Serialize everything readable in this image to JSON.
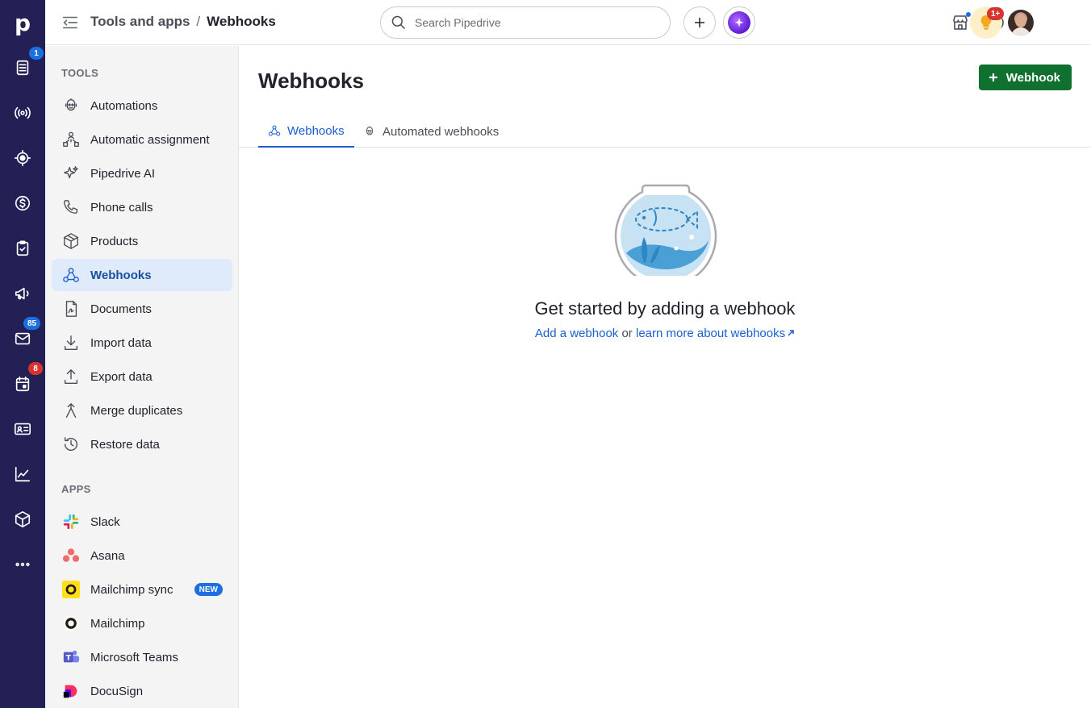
{
  "rail": {
    "logo": "p",
    "badges": {
      "leads": "1",
      "mail": "85",
      "calendar": "8"
    }
  },
  "topbar": {
    "breadcrumb_parent": "Tools and apps",
    "breadcrumb_sep": "/",
    "breadcrumb_current": "Webhooks",
    "search_placeholder": "Search Pipedrive",
    "notif_badge": "1+"
  },
  "sidebar": {
    "tools_title": "TOOLS",
    "tools": [
      {
        "label": "Automations",
        "icon": "automation-robot-icon"
      },
      {
        "label": "Automatic assignment",
        "icon": "assignment-icon"
      },
      {
        "label": "Pipedrive AI",
        "icon": "sparkle-icon"
      },
      {
        "label": "Phone calls",
        "icon": "phone-icon"
      },
      {
        "label": "Products",
        "icon": "box-icon"
      },
      {
        "label": "Webhooks",
        "icon": "webhook-icon",
        "active": true
      },
      {
        "label": "Documents",
        "icon": "document-icon"
      },
      {
        "label": "Import data",
        "icon": "download-icon"
      },
      {
        "label": "Export data",
        "icon": "upload-icon"
      },
      {
        "label": "Merge duplicates",
        "icon": "merge-icon"
      },
      {
        "label": "Restore data",
        "icon": "restore-icon"
      }
    ],
    "apps_title": "APPS",
    "apps": [
      {
        "label": "Slack",
        "icon": "slack-icon"
      },
      {
        "label": "Asana",
        "icon": "asana-icon"
      },
      {
        "label": "Mailchimp sync",
        "icon": "mailchimp-sync-icon",
        "badge": "NEW"
      },
      {
        "label": "Mailchimp",
        "icon": "mailchimp-icon"
      },
      {
        "label": "Microsoft Teams",
        "icon": "teams-icon"
      },
      {
        "label": "DocuSign",
        "icon": "docusign-icon"
      }
    ]
  },
  "main": {
    "title": "Webhooks",
    "add_button": "Webhook",
    "tabs": [
      {
        "label": "Webhooks",
        "active": true
      },
      {
        "label": "Automated webhooks",
        "active": false
      }
    ],
    "empty_title": "Get started by adding a webhook",
    "empty_link_add": "Add a webhook",
    "empty_or": " or ",
    "empty_link_learn": "learn more about webhooks"
  },
  "colors": {
    "rail_bg": "#222054",
    "accent": "#1a5fd0",
    "primary_button": "#107030",
    "active_nav_bg": "#dfeafb"
  }
}
